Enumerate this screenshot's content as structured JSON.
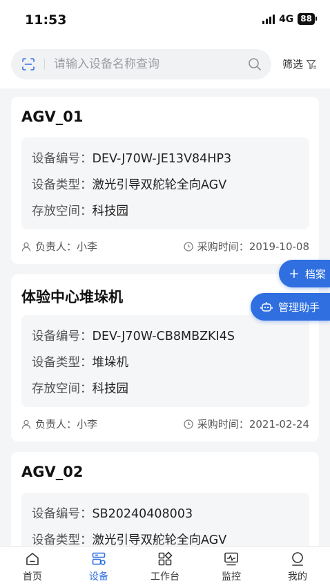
{
  "status_bar": {
    "time": "11:53",
    "network": "4G",
    "battery": "88"
  },
  "search": {
    "placeholder": "请输入设备名称查询",
    "value": "",
    "filter_label": "筛选"
  },
  "labels": {
    "device_no": "设备编号：",
    "device_type": "设备类型：",
    "storage_space": "存放空间：",
    "owner": "负责人：",
    "purchase_time": "采购时间："
  },
  "devices": [
    {
      "name": "AGV_01",
      "device_no": "DEV-J70W-JE13V84HP3",
      "device_type": "激光引导双舵轮全向AGV",
      "storage_space": "科技园",
      "owner": "小李",
      "purchase_time": "2019-10-08"
    },
    {
      "name": "体验中心堆垛机",
      "device_no": "DEV-J70W-CB8MBZKI4S",
      "device_type": "堆垛机",
      "storage_space": "科技园",
      "owner": "小李",
      "purchase_time": "2021-02-24"
    },
    {
      "name": "AGV_02",
      "device_no": "SB20240408003",
      "device_type": "激光引导双舵轮全向AGV"
    }
  ],
  "floating_buttons": {
    "archive": "档案",
    "assistant": "管理助手"
  },
  "tabs": [
    {
      "label": "首页",
      "icon": "home-icon"
    },
    {
      "label": "设备",
      "icon": "device-icon"
    },
    {
      "label": "工作台",
      "icon": "workbench-icon"
    },
    {
      "label": "监控",
      "icon": "monitor-icon"
    },
    {
      "label": "我的",
      "icon": "profile-icon"
    }
  ],
  "colors": {
    "accent": "#2f6fe0",
    "background": "#f4f5f7",
    "card": "#ffffff",
    "info_box": "#f5f6f8"
  }
}
